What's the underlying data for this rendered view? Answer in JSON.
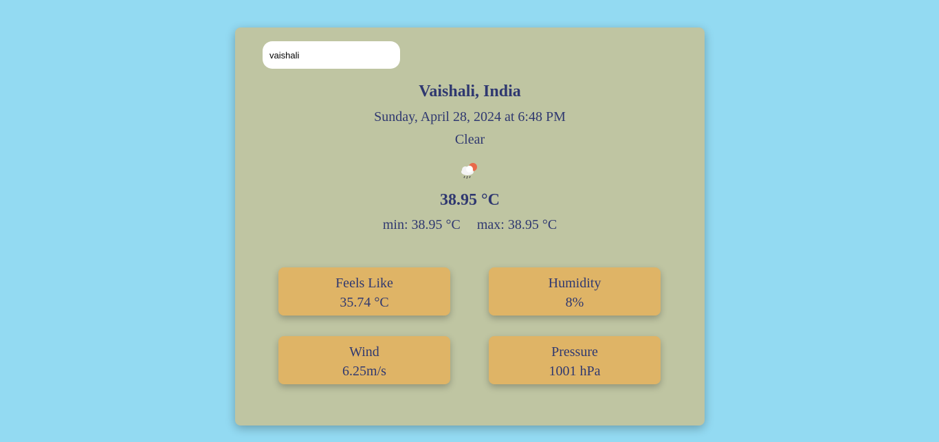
{
  "search": {
    "value": "vaishali"
  },
  "location": "Vaishali, India",
  "datetime": "Sunday, April 28, 2024 at 6:48 PM",
  "condition": "Clear",
  "weather_icon": "cloud-sun-rain-icon",
  "temperature": "38.95 °C",
  "min": "min: 38.95 °C",
  "max": "max: 38.95 °C",
  "details": {
    "feels_like": {
      "label": "Feels Like",
      "value": "35.74 °C"
    },
    "humidity": {
      "label": "Humidity",
      "value": "8%"
    },
    "wind": {
      "label": "Wind",
      "value": "6.25m/s"
    },
    "pressure": {
      "label": "Pressure",
      "value": "1001 hPa"
    }
  },
  "colors": {
    "background": "#93daf2",
    "card": "#bfc5a2",
    "tile": "#dfb466",
    "text": "#2f3870"
  }
}
